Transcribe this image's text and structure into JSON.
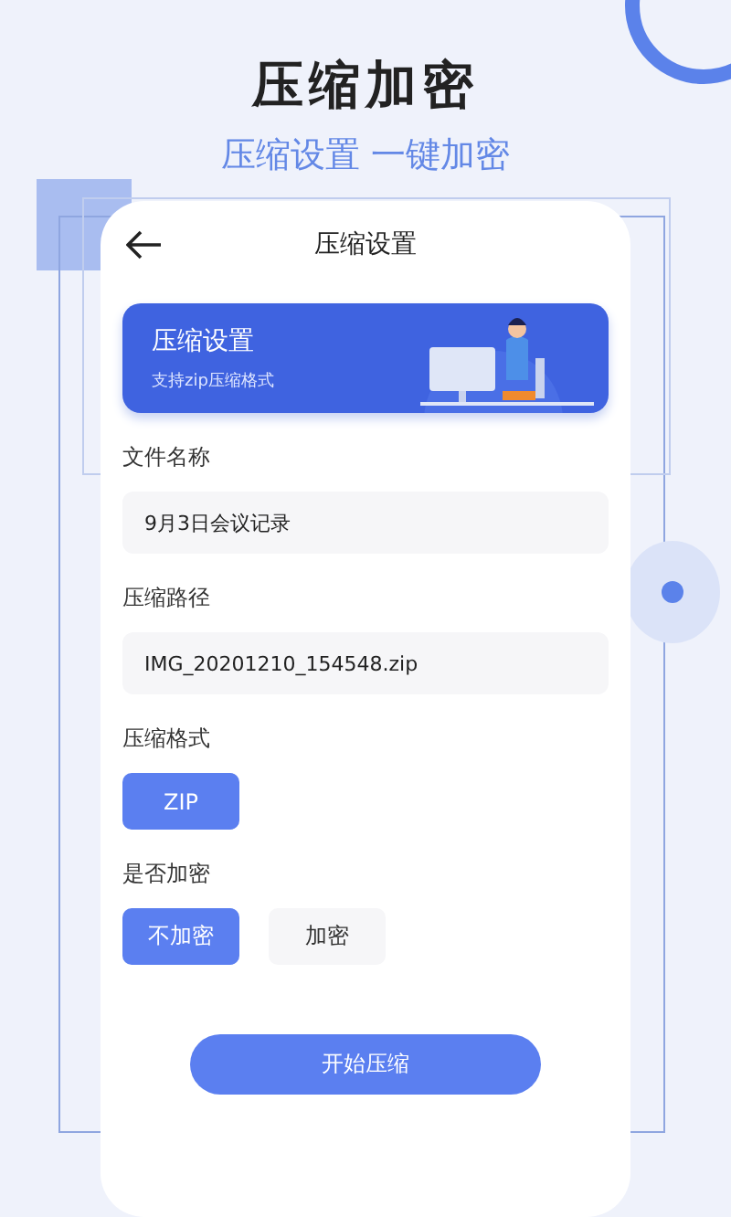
{
  "headline": "压缩加密",
  "subtitle": "压缩设置 一键加密",
  "screen": {
    "title": "压缩设置",
    "banner": {
      "title": "压缩设置",
      "caption": "支持zip压缩格式"
    },
    "fields": [
      {
        "label": "文件名称",
        "value": "9月3日会议记录"
      },
      {
        "label": "压缩路径",
        "value": "IMG_20201210_154548.zip"
      }
    ],
    "format": {
      "label": "压缩格式",
      "options": [
        {
          "label": "ZIP",
          "selected": true
        }
      ]
    },
    "encryption": {
      "label": "是否加密",
      "options": [
        {
          "label": "不加密",
          "selected": true
        },
        {
          "label": "加密",
          "selected": false
        }
      ]
    },
    "start_button": "开始压缩"
  }
}
